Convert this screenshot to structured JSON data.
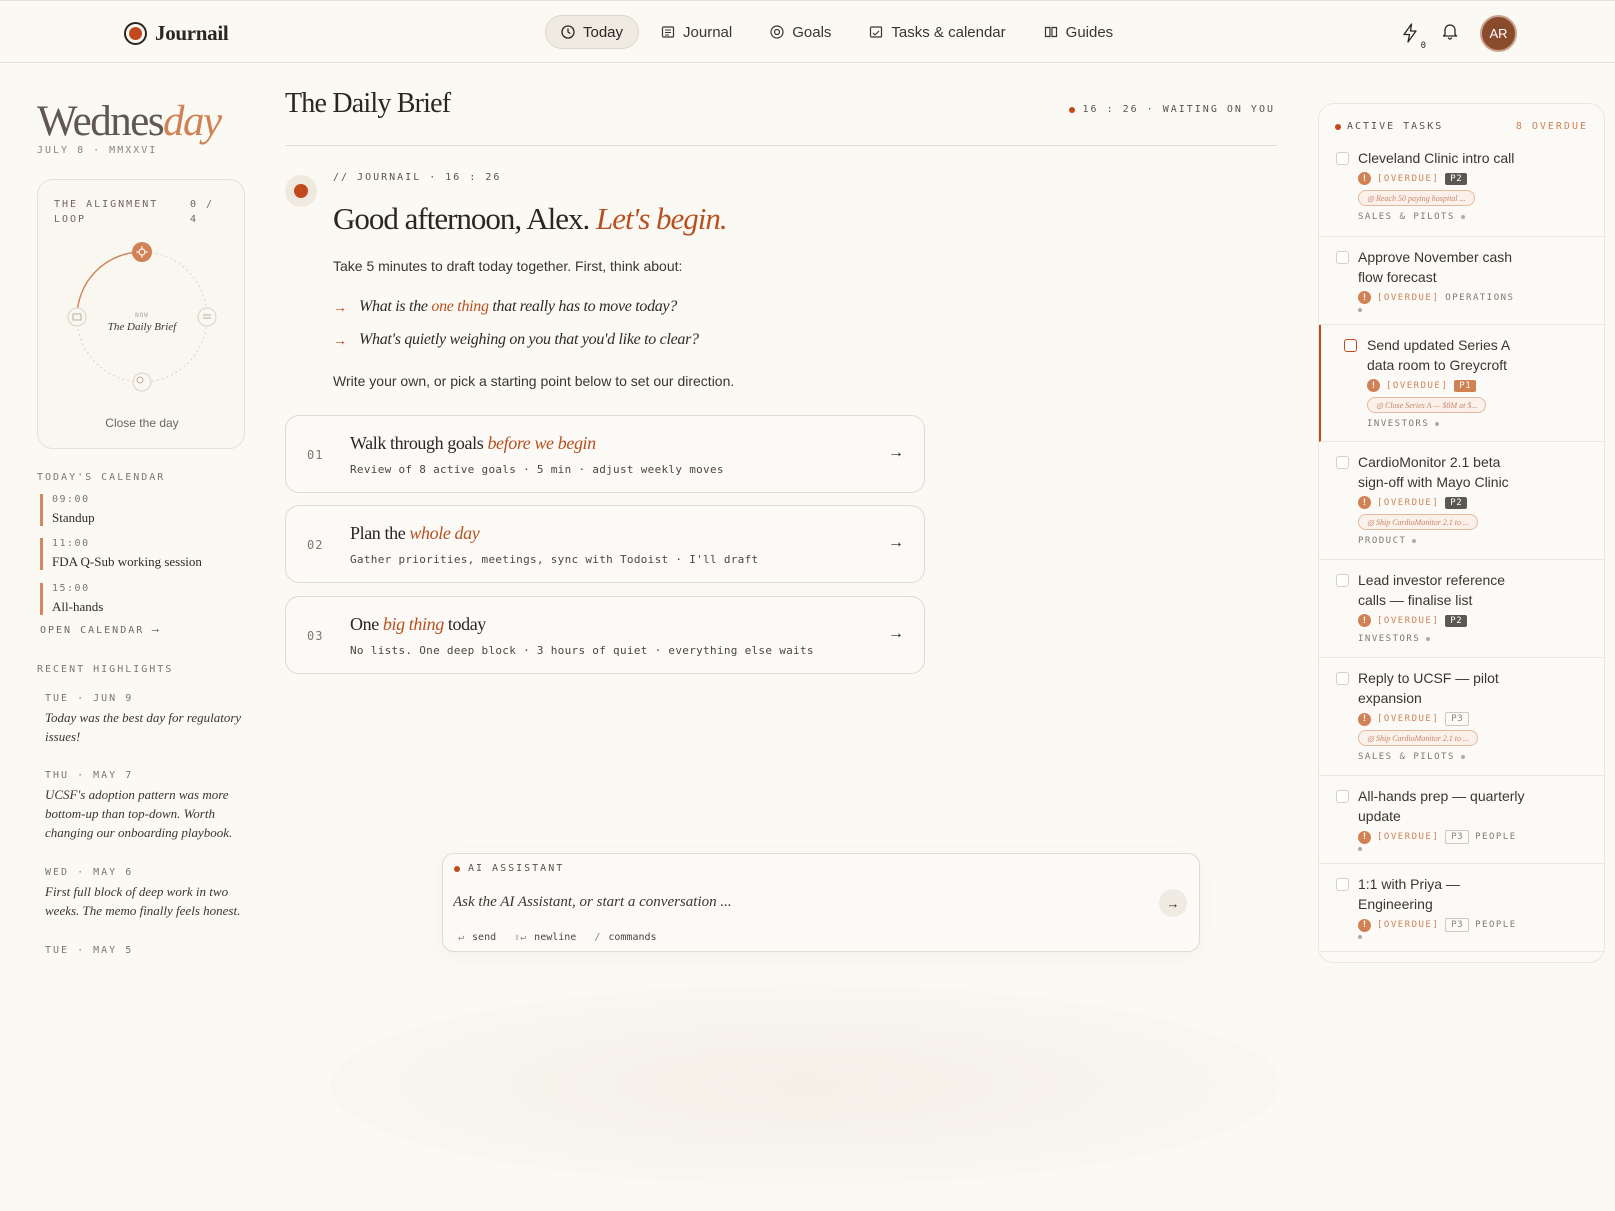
{
  "app": {
    "name": "Journail",
    "avatar_initials": "AR",
    "bolt_count": "0"
  },
  "nav": [
    {
      "label": "Today",
      "icon": "clock-icon",
      "active": true
    },
    {
      "label": "Journal",
      "icon": "journal-icon"
    },
    {
      "label": "Goals",
      "icon": "target-icon"
    },
    {
      "label": "Tasks & calendar",
      "icon": "calendar-icon"
    },
    {
      "label": "Guides",
      "icon": "book-icon"
    }
  ],
  "left": {
    "day_plain": "Wednes",
    "day_accent": "day",
    "date": "JULY 8 · MMXXVI",
    "loop": {
      "title": "THE ALIGNMENT LOOP",
      "count": "0 / 4",
      "now": "NOW",
      "name": "The Daily Brief",
      "close": "Close the day"
    },
    "calendar_label": "TODAY'S CALENDAR",
    "calendar": [
      {
        "time": "09:00",
        "title": "Standup"
      },
      {
        "time": "11:00",
        "title": "FDA Q-Sub working session"
      },
      {
        "time": "15:00",
        "title": "All-hands"
      }
    ],
    "open_calendar": "OPEN CALENDAR ⟶",
    "highlights_label": "RECENT HIGHLIGHTS",
    "highlights": [
      {
        "date": "TUE · JUN 9",
        "text": "Today was the best day for regulatory issues!"
      },
      {
        "date": "THU · MAY 7",
        "text": "UCSF's adoption pattern was more bottom-up than top-down. Worth changing our onboarding playbook."
      },
      {
        "date": "WED · MAY 6",
        "text": "First full block of deep work in two weeks. The memo finally feels honest."
      },
      {
        "date": "TUE · MAY 5",
        "text": ""
      }
    ]
  },
  "brief": {
    "title": "The Daily Brief",
    "time": "16 : 26",
    "status": "WAITING ON YOU",
    "meta": "// JOURNAIL · 16 : 26",
    "greeting_plain": "Good afternoon, Alex. ",
    "greeting_accent": "Let's begin.",
    "intro": "Take 5 minutes to draft today together. First, think about:",
    "prompt1": {
      "before": "What is the ",
      "accent": "one thing",
      "after": " that really has to move today?"
    },
    "prompt2": "What's quietly weighing on you that you'd like to clear?",
    "write_own": "Write your own, or pick a starting point below to set our direction.",
    "options": [
      {
        "num": "01",
        "plain": "Walk through goals ",
        "accent": "before we begin",
        "after": "",
        "sub": "Review of 8 active goals · 5 min · adjust weekly moves"
      },
      {
        "num": "02",
        "plain": "Plan the ",
        "accent": "whole day",
        "after": "",
        "sub": "Gather priorities, meetings, sync with Todoist · I'll draft"
      },
      {
        "num": "03",
        "plain": "One ",
        "accent": "big thing",
        "after": " today",
        "sub": "No lists. One deep block · 3 hours of quiet · everything else waits"
      }
    ]
  },
  "assistant": {
    "label": "AI ASSISTANT",
    "placeholder": "Ask the AI Assistant, or start a conversation ...",
    "hints": [
      {
        "key": "↵",
        "label": "send"
      },
      {
        "key": "⇧↵",
        "label": "newline"
      },
      {
        "key": "/",
        "label": "commands"
      }
    ]
  },
  "tasks": {
    "label": "ACTIVE TASKS",
    "overdue": "8 OVERDUE",
    "items": [
      {
        "title": "Cleveland Clinic intro call",
        "status": "[OVERDUE]",
        "priority": "P2",
        "category": "",
        "goal": "◎ Reach 50 paying hospital ...",
        "footer": "SALES & PILOTS"
      },
      {
        "title": "Approve November cash flow forecast",
        "status": "[OVERDUE]",
        "priority": "",
        "category": "OPERATIONS",
        "goal": "",
        "footer": ""
      },
      {
        "title": "Send updated Series A data room to Greycroft",
        "status": "[OVERDUE]",
        "priority": "P1",
        "category": "",
        "goal": "◎ Close Series A — $8M at $...",
        "footer": "INVESTORS"
      },
      {
        "title": "CardioMonitor 2.1 beta sign-off with Mayo Clinic",
        "status": "[OVERDUE]",
        "priority": "P2",
        "category": "",
        "goal": "◎ Ship CardioMonitor 2.1 to ...",
        "footer": "PRODUCT"
      },
      {
        "title": "Lead investor reference calls — finalise list",
        "status": "[OVERDUE]",
        "priority": "P2",
        "category": "",
        "goal": "",
        "footer": "INVESTORS"
      },
      {
        "title": "Reply to UCSF — pilot expansion",
        "status": "[OVERDUE]",
        "priority": "P3",
        "category": "",
        "goal": "◎ Ship CardioMonitor 2.1 to ...",
        "footer": "SALES & PILOTS"
      },
      {
        "title": "All-hands prep — quarterly update",
        "status": "[OVERDUE]",
        "priority": "P3",
        "category": "PEOPLE",
        "goal": "",
        "footer": ""
      },
      {
        "title": "1:1 with Priya — Engineering",
        "status": "[OVERDUE]",
        "priority": "P3",
        "category": "PEOPLE",
        "goal": "",
        "footer": ""
      }
    ]
  },
  "colors": {
    "accent": "#c2491d",
    "accent_soft": "#d08255",
    "background": "#fbf9f4"
  }
}
